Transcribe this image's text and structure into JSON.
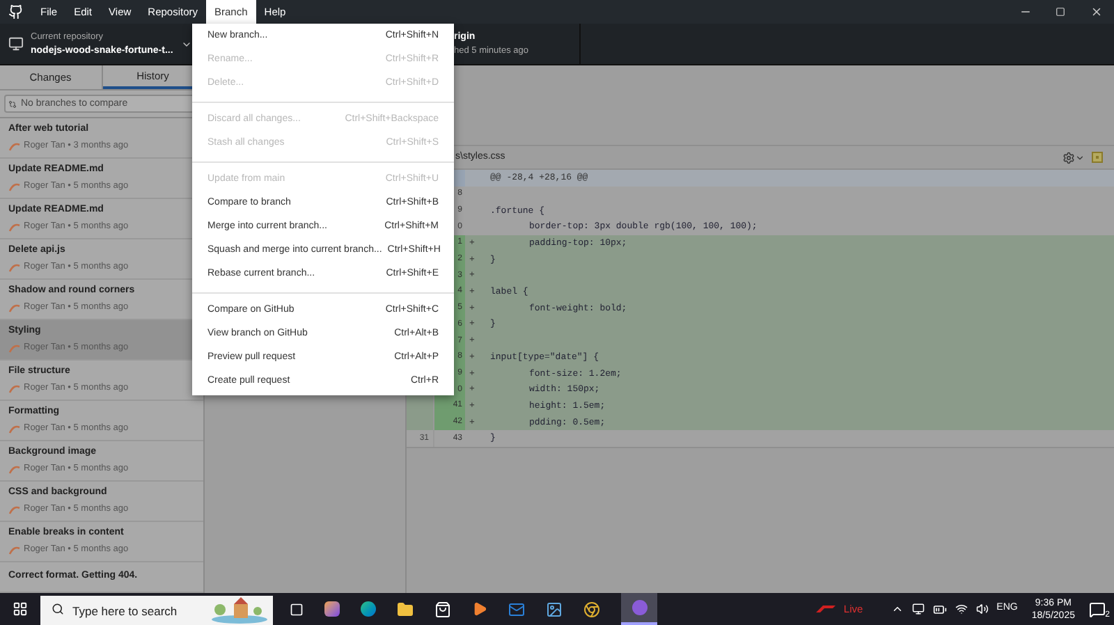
{
  "menubar": [
    {
      "label": "File",
      "selected": false
    },
    {
      "label": "Edit",
      "selected": false
    },
    {
      "label": "View",
      "selected": false
    },
    {
      "label": "Repository",
      "selected": false
    },
    {
      "label": "Branch",
      "selected": true
    },
    {
      "label": "Help",
      "selected": false
    }
  ],
  "toolbar": {
    "repository_label": "Current repository",
    "repository": "nodejs-wood-snake-fortune-t...",
    "fetch_title": "rigin",
    "fetch_subtitle": "hed 5 minutes ago"
  },
  "tabs": [
    {
      "label": "Changes",
      "selected": false
    },
    {
      "label": "History",
      "selected": true
    }
  ],
  "compare": {
    "placeholder": "No branches to compare"
  },
  "commits": [
    {
      "title": "After web tutorial",
      "meta": "Roger Tan • 3 months ago",
      "selected": false
    },
    {
      "title": "Update README.md",
      "meta": "Roger Tan • 5 months ago",
      "selected": false
    },
    {
      "title": "Update README.md",
      "meta": "Roger Tan • 5 months ago",
      "selected": false
    },
    {
      "title": "Delete api.js",
      "meta": "Roger Tan • 5 months ago",
      "selected": false
    },
    {
      "title": "Shadow and round corners",
      "meta": "Roger Tan • 5 months ago",
      "selected": false
    },
    {
      "title": "Styling",
      "meta": "Roger Tan • 5 months ago",
      "selected": true
    },
    {
      "title": "File structure",
      "meta": "Roger Tan • 5 months ago",
      "selected": false
    },
    {
      "title": "Formatting",
      "meta": "Roger Tan • 5 months ago",
      "selected": false
    },
    {
      "title": "Background image",
      "meta": "Roger Tan • 5 months ago",
      "selected": false
    },
    {
      "title": "CSS and background",
      "meta": "Roger Tan • 5 months ago",
      "selected": false
    },
    {
      "title": "Enable breaks in content",
      "meta": "Roger Tan • 5 months ago",
      "selected": false
    },
    {
      "title": "Correct format. Getting 404.",
      "selected": false
    }
  ],
  "diff": {
    "file": "s\\styles.css",
    "hunk": "@@ -28,4 +28,16 @@",
    "lines": [
      {
        "kind": "context",
        "new": "8",
        "indented": false
      },
      {
        "kind": "context",
        "new": "9",
        "code": ".fortune {",
        "indented": false
      },
      {
        "kind": "context",
        "new": "0",
        "code": "border-top: 3px double rgb(100, 100, 100);",
        "indented": true
      },
      {
        "kind": "added",
        "new": "1",
        "sign": "+",
        "code": "padding-top: 10px;",
        "indented": true
      },
      {
        "kind": "added",
        "new": "2",
        "sign": "+",
        "code": "}",
        "indented": false
      },
      {
        "kind": "added",
        "new": "3",
        "sign": "+",
        "indented": false
      },
      {
        "kind": "added",
        "new": "4",
        "sign": "+",
        "code": "label {",
        "indented": false
      },
      {
        "kind": "added",
        "new": "5",
        "sign": "+",
        "code": "font-weight: bold;",
        "indented": true
      },
      {
        "kind": "added",
        "new": "6",
        "sign": "+",
        "code": "}",
        "indented": false
      },
      {
        "kind": "added",
        "new": "7",
        "sign": "+",
        "indented": false
      },
      {
        "kind": "added",
        "new": "8",
        "sign": "+",
        "code": "input[type=\"date\"] {",
        "indented": false
      },
      {
        "kind": "added",
        "new": "9",
        "sign": "+",
        "code": "font-size: 1.2em;",
        "indented": true
      },
      {
        "kind": "added",
        "new": "0",
        "sign": "+",
        "code": "width: 150px;",
        "indented": true
      },
      {
        "kind": "added",
        "new": "41",
        "sign": "+",
        "code": "height: 1.5em;",
        "indented": true
      },
      {
        "kind": "added",
        "new": "42",
        "sign": "+",
        "code": "pdding: 0.5em;",
        "indented": true
      },
      {
        "kind": "context",
        "old": "31",
        "new": "43",
        "code": "}",
        "indented": false
      }
    ]
  },
  "menu": [
    {
      "label": "New branch...",
      "shortcut": "Ctrl+Shift+N",
      "disabled": false
    },
    {
      "label": "Rename...",
      "shortcut": "Ctrl+Shift+R",
      "disabled": true
    },
    {
      "label": "Delete...",
      "shortcut": "Ctrl+Shift+D",
      "disabled": true
    },
    {
      "kind": "separator"
    },
    {
      "label": "Discard all changes...",
      "shortcut": "Ctrl+Shift+Backspace",
      "disabled": true
    },
    {
      "label": "Stash all changes",
      "shortcut": "Ctrl+Shift+S",
      "disabled": true
    },
    {
      "kind": "separator"
    },
    {
      "label": "Update from main",
      "shortcut": "Ctrl+Shift+U",
      "disabled": true
    },
    {
      "label": "Compare to branch",
      "shortcut": "Ctrl+Shift+B",
      "disabled": false
    },
    {
      "label": "Merge into current branch...",
      "shortcut": "Ctrl+Shift+M",
      "disabled": false
    },
    {
      "label": "Squash and merge into current branch...",
      "shortcut": "Ctrl+Shift+H",
      "disabled": false
    },
    {
      "label": "Rebase current branch...",
      "shortcut": "Ctrl+Shift+E",
      "disabled": false
    },
    {
      "kind": "separator"
    },
    {
      "label": "Compare on GitHub",
      "shortcut": "Ctrl+Shift+C",
      "disabled": false
    },
    {
      "label": "View branch on GitHub",
      "shortcut": "Ctrl+Alt+B",
      "disabled": false
    },
    {
      "label": "Preview pull request",
      "shortcut": "Ctrl+Alt+P",
      "disabled": false
    },
    {
      "label": "Create pull request",
      "shortcut": "Ctrl+R",
      "disabled": false
    }
  ],
  "taskbar": {
    "search_placeholder": "Type here to search",
    "live": "Live",
    "language": "ENG",
    "time": "9:36 PM",
    "date": "18/5/2025",
    "notifications": "2"
  }
}
